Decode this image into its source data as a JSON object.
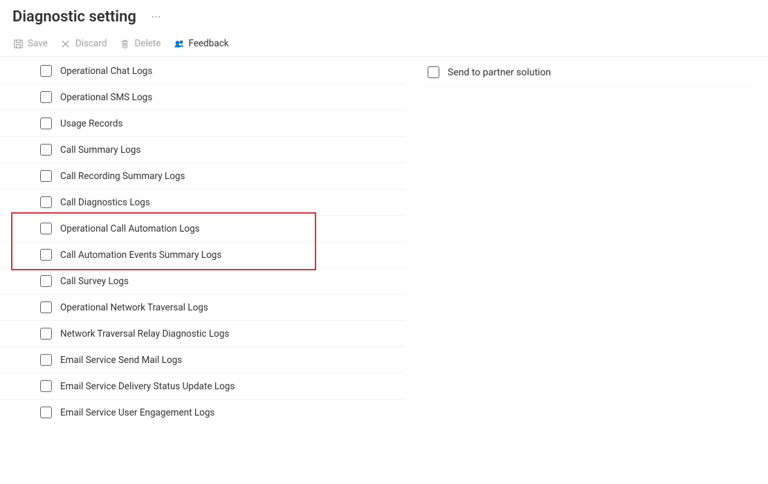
{
  "page": {
    "title": "Diagnostic setting"
  },
  "toolbar": {
    "save_label": "Save",
    "discard_label": "Discard",
    "delete_label": "Delete",
    "feedback_label": "Feedback"
  },
  "log_categories": [
    {
      "label": "Operational Chat Logs",
      "checked": false
    },
    {
      "label": "Operational SMS Logs",
      "checked": false
    },
    {
      "label": "Usage Records",
      "checked": false
    },
    {
      "label": "Call Summary Logs",
      "checked": false
    },
    {
      "label": "Call Recording Summary Logs",
      "checked": false
    },
    {
      "label": "Call Diagnostics Logs",
      "checked": false
    },
    {
      "label": "Operational Call Automation Logs",
      "checked": false
    },
    {
      "label": "Call Automation Events Summary Logs",
      "checked": false
    },
    {
      "label": "Call Survey Logs",
      "checked": false
    },
    {
      "label": "Operational Network Traversal Logs",
      "checked": false
    },
    {
      "label": "Network Traversal Relay Diagnostic Logs",
      "checked": false
    },
    {
      "label": "Email Service Send Mail Logs",
      "checked": false
    },
    {
      "label": "Email Service Delivery Status Update Logs",
      "checked": false
    },
    {
      "label": "Email Service User Engagement Logs",
      "checked": false
    }
  ],
  "highlight": {
    "start_index": 6,
    "end_index": 7
  },
  "destinations": [
    {
      "label": "Send to partner solution",
      "checked": false
    }
  ]
}
